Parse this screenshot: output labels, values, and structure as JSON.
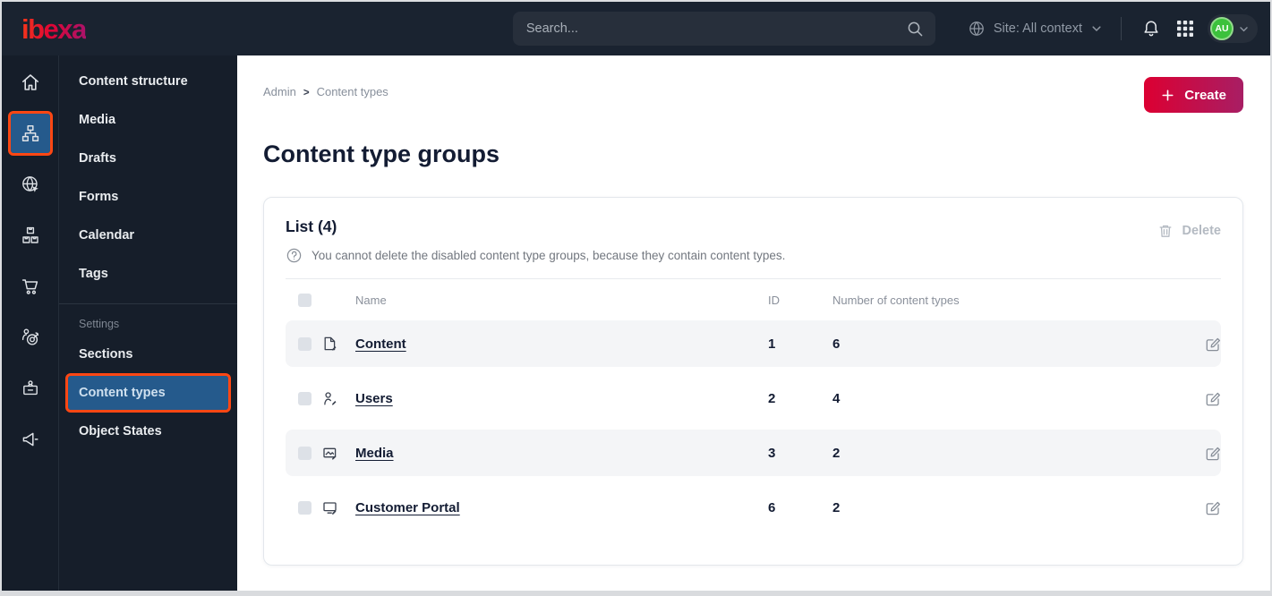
{
  "topbar": {
    "logo_text": "ibexa",
    "search_placeholder": "Search...",
    "site_context_label": "Site: All context",
    "avatar_initials": "AU",
    "icons": [
      "search-icon",
      "site-globe-icon",
      "chevron-down-icon",
      "notifications-bell-icon",
      "apps-grid-icon"
    ]
  },
  "nav_rail": {
    "active_item": "content-structure",
    "icons": [
      "home-icon",
      "content-structure-icon",
      "site-icon",
      "product-catalog-icon",
      "commerce-cart-icon",
      "personalization-target-icon",
      "admin-badge-icon",
      "campaign-megaphone-icon"
    ]
  },
  "menu": {
    "items": [
      "Content structure",
      "Media",
      "Drafts",
      "Forms",
      "Calendar",
      "Tags"
    ],
    "settings_label": "Settings",
    "settings_items": [
      "Sections",
      "Content types",
      "Object States"
    ],
    "active_item": "Content types"
  },
  "main": {
    "breadcrumb": {
      "items": [
        "Admin",
        "Content types"
      ],
      "separator": ">"
    },
    "create_button": "Create",
    "page_title": "Content type groups",
    "list": {
      "title": "List (4)",
      "help_text": "You cannot delete the disabled content type groups, because they contain content types.",
      "delete_button": "Delete",
      "columns": {
        "name": "Name",
        "id": "ID",
        "count": "Number of content types"
      },
      "rows": [
        {
          "icon": "content-file-icon",
          "name": "Content",
          "id": "1",
          "count": "6"
        },
        {
          "icon": "users-person-icon",
          "name": "Users",
          "id": "2",
          "count": "4"
        },
        {
          "icon": "media-image-icon",
          "name": "Media",
          "id": "3",
          "count": "2"
        },
        {
          "icon": "customer-portal-monitor-icon",
          "name": "Customer Portal",
          "id": "6",
          "count": "2"
        }
      ]
    }
  },
  "colors": {
    "topbar_bg": "#1a2330",
    "rail_bg": "#151d29",
    "panel_bg": "#161e2a",
    "active_highlight_blue": "#255a8c",
    "accent_orange": "#ff4713",
    "create_gradient_start": "#dc0032",
    "create_gradient_end": "#a81e64",
    "avatar_green": "#3cc13c",
    "link_text": "#131c33",
    "row_alt_bg": "#f4f5f7"
  }
}
